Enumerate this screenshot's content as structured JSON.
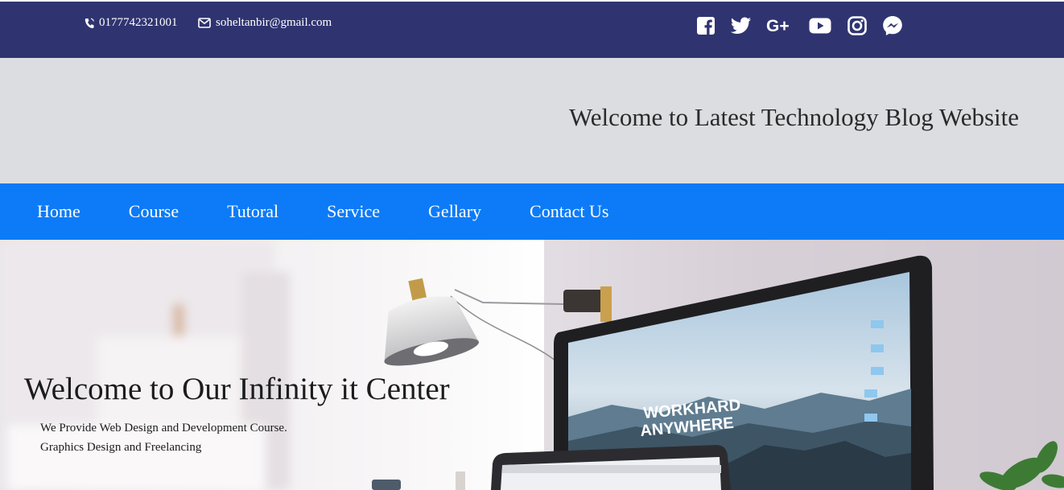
{
  "topbar": {
    "phone": "0177742321001",
    "email": "soheltanbir@gmail.com",
    "socials": [
      "facebook-icon",
      "twitter-icon",
      "google-plus-icon",
      "youtube-icon",
      "instagram-icon",
      "messenger-icon"
    ],
    "google_plus_text": "G+"
  },
  "header": {
    "title": "Welcome to Latest Technology Blog Website"
  },
  "nav": {
    "items": [
      {
        "label": "Home"
      },
      {
        "label": "Course"
      },
      {
        "label": "Tutoral"
      },
      {
        "label": "Service"
      },
      {
        "label": "Gellary"
      },
      {
        "label": "Contact Us"
      }
    ]
  },
  "hero": {
    "title": "Welcome to Our Infinity it Center",
    "line1": "We Provide Web Design and Development Course.",
    "line2": "Graphics Design and Freelancing",
    "screen_text_1": "WORKHARD",
    "screen_text_2": "ANYWHERE"
  },
  "colors": {
    "topbar": "#2f3470",
    "header_band": "#dcdde1",
    "nav": "#0d7bf7",
    "text_dark": "#1c1c1c"
  }
}
